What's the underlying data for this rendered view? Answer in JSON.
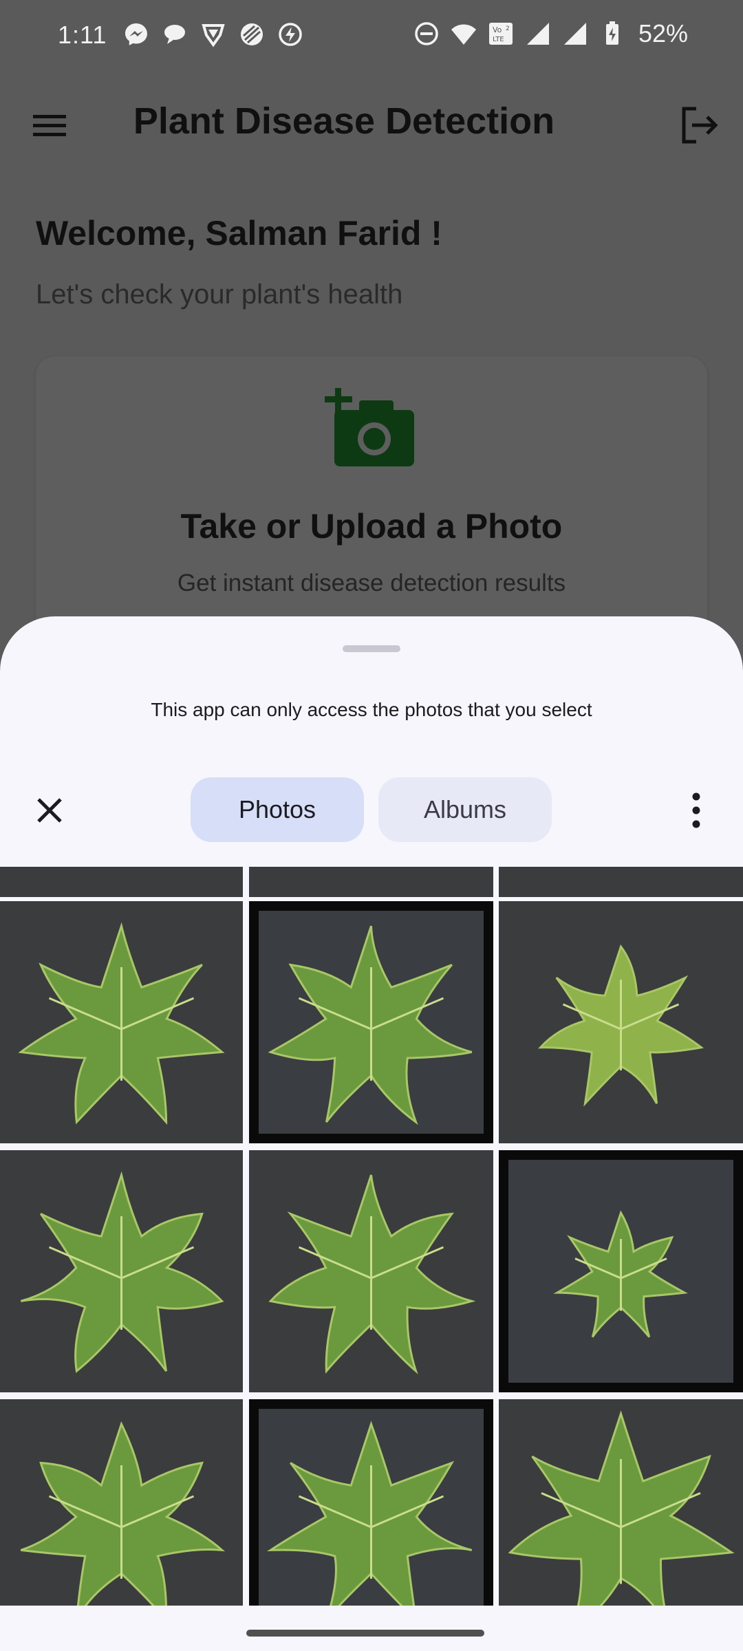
{
  "status_bar": {
    "time": "1:11",
    "battery": "52%",
    "left_icons": [
      "messenger-icon",
      "chat-bubble-icon",
      "vpn-shield-icon",
      "app-icon",
      "bolt-icon"
    ],
    "right_icons": [
      "do-not-disturb-icon",
      "wifi-icon",
      "volte-icon",
      "signal-icon",
      "signal-icon",
      "battery-charging-icon"
    ]
  },
  "app_bar": {
    "title": "Plant Disease Detection",
    "menu_icon": "hamburger-menu-icon",
    "logout_icon": "logout-icon"
  },
  "home": {
    "welcome": "Welcome, Salman Farid !",
    "subtitle": "Let's check your plant's health",
    "card_title": "Take or Upload a Photo",
    "card_subtitle": "Get instant disease detection results",
    "card_icon": "add-photo-camera-icon",
    "accent_color": "#1b5e20"
  },
  "picker": {
    "access_note": "This app can only access the photos that you select",
    "close_icon": "close-icon",
    "tabs": [
      {
        "label": "Photos",
        "selected": true
      },
      {
        "label": "Albums",
        "selected": false
      }
    ],
    "more_icon": "more-vertical-icon",
    "photos": [
      {
        "label": "partial-photo"
      },
      {
        "label": "partial-photo"
      },
      {
        "label": "partial-photo"
      },
      {
        "label": "watermelon-leaf"
      },
      {
        "label": "watermelon-leaf-framed"
      },
      {
        "label": "watermelon-leaf-yellow"
      },
      {
        "label": "watermelon-leaf"
      },
      {
        "label": "watermelon-leaf"
      },
      {
        "label": "watermelon-leaf-framed-small"
      },
      {
        "label": "watermelon-leaf"
      },
      {
        "label": "watermelon-leaf-framed"
      },
      {
        "label": "watermelon-leaf-large"
      }
    ]
  }
}
